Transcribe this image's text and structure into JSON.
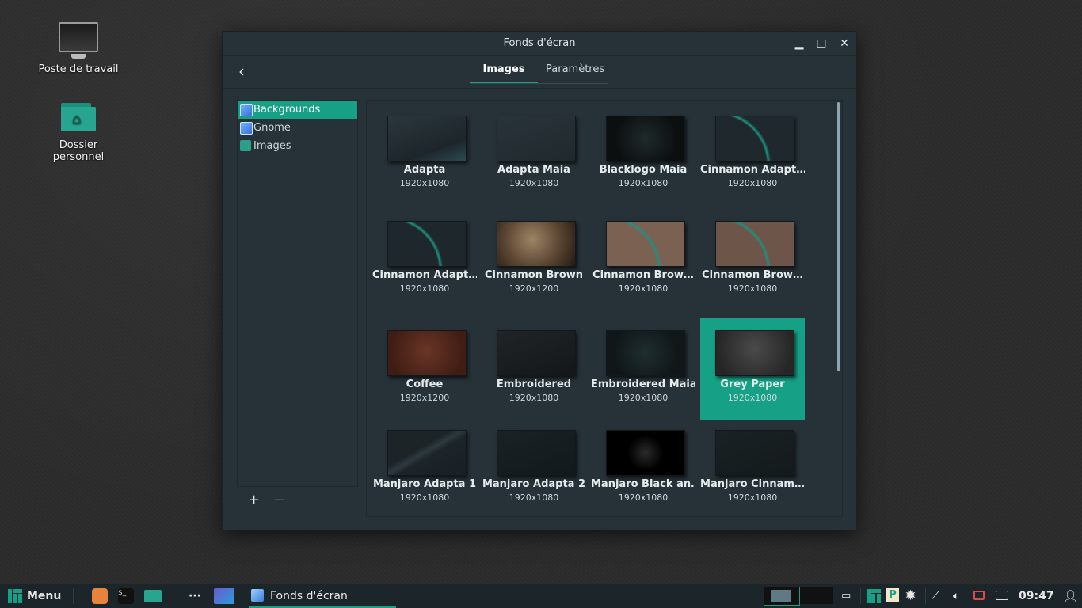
{
  "desktop": {
    "icons": [
      {
        "label": "Poste de travail"
      },
      {
        "label": "Dossier personnel"
      }
    ]
  },
  "window": {
    "title": "Fonds d'écran",
    "tabs": [
      {
        "label": "Images",
        "active": true
      },
      {
        "label": "Paramètres",
        "active": false
      }
    ],
    "sidebar": {
      "items": [
        {
          "label": "Backgrounds",
          "icon": "image-icon",
          "active": true
        },
        {
          "label": "Gnome",
          "icon": "image-icon",
          "active": false
        },
        {
          "label": "Images",
          "icon": "folder-icon",
          "active": false
        }
      ],
      "add_label": "+",
      "remove_label": "−"
    },
    "wallpapers": [
      {
        "name": "Adapta",
        "res": "1920x1080"
      },
      {
        "name": "Adapta Maia",
        "res": "1920x1080"
      },
      {
        "name": "Blacklogo Maia",
        "res": "1920x1080"
      },
      {
        "name": "Cinnamon Adapt…",
        "res": "1920x1080"
      },
      {
        "name": "Cinnamon Adapt…",
        "res": "1920x1080"
      },
      {
        "name": "Cinnamon Brown",
        "res": "1920x1200"
      },
      {
        "name": "Cinnamon Brow…",
        "res": "1920x1080"
      },
      {
        "name": "Cinnamon Brow…",
        "res": "1920x1080"
      },
      {
        "name": "Coffee",
        "res": "1920x1200"
      },
      {
        "name": "Embroidered",
        "res": "1920x1080"
      },
      {
        "name": "Embroidered Maia",
        "res": "1920x1080"
      },
      {
        "name": "Grey Paper",
        "res": "1920x1080",
        "selected": true
      },
      {
        "name": "Manjaro Adapta 1",
        "res": "1920x1080"
      },
      {
        "name": "Manjaro Adapta 2",
        "res": "1920x1080"
      },
      {
        "name": "Manjaro Black an…",
        "res": "1920x1080"
      },
      {
        "name": "Manjaro Cinnam…",
        "res": "1920x1080"
      }
    ]
  },
  "taskbar": {
    "menu_label": "Menu",
    "window_button_label": "Fonds d'écran",
    "more_label": "···",
    "clock": "09:47",
    "accent": "#16a085"
  }
}
